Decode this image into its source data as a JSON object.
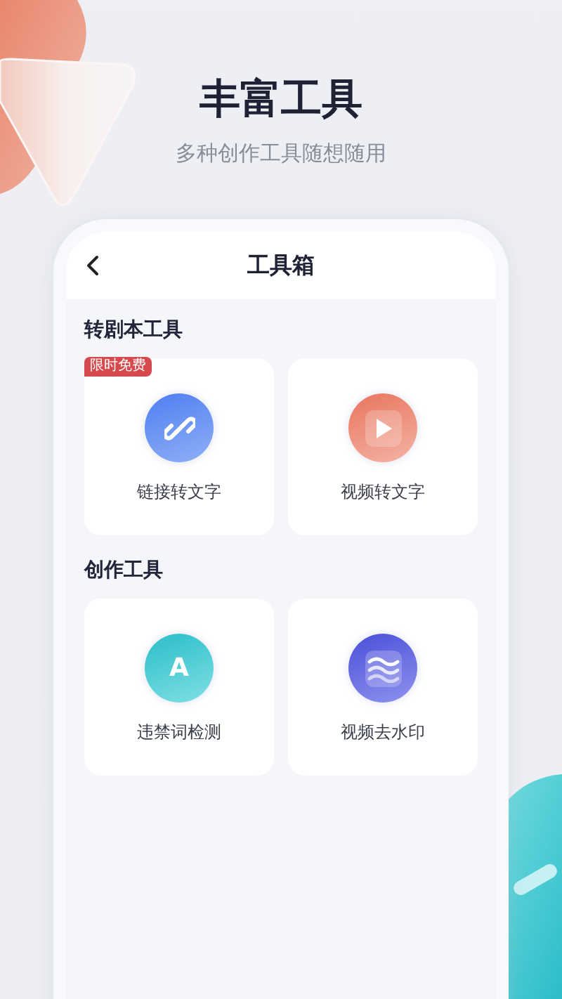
{
  "headline": "丰富工具",
  "subtitle": "多种创作工具随想随用",
  "screen": {
    "title": "工具箱",
    "sections": [
      {
        "title": "转剧本工具",
        "tools": [
          {
            "label": "链接转文字",
            "kind": "link",
            "badge": "限时免费"
          },
          {
            "label": "视频转文字",
            "kind": "play"
          }
        ]
      },
      {
        "title": "创作工具",
        "tools": [
          {
            "label": "违禁词检测",
            "kind": "letter",
            "glyph": "A"
          },
          {
            "label": "视频去水印",
            "kind": "waves"
          }
        ]
      }
    ]
  }
}
